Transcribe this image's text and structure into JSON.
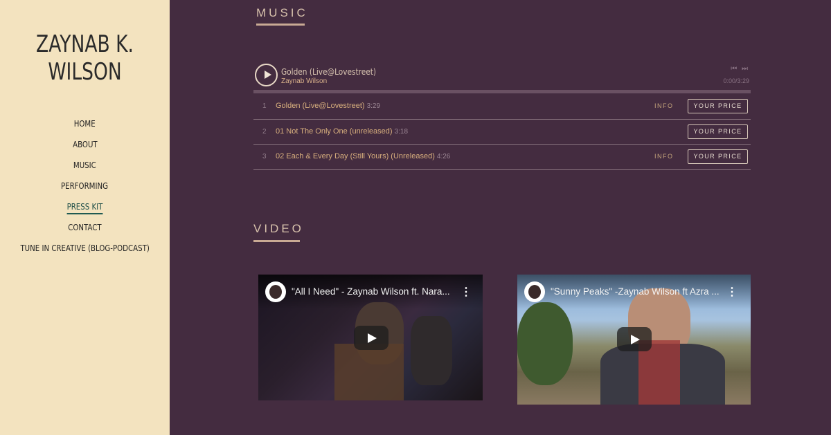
{
  "sidebar": {
    "title_line1": "ZAYNAB K.",
    "title_line2": "WILSON",
    "nav": [
      {
        "label": "HOME"
      },
      {
        "label": "ABOUT"
      },
      {
        "label": "MUSIC"
      },
      {
        "label": "PERFORMING"
      },
      {
        "label": "PRESS KIT",
        "active": true
      },
      {
        "label": "CONTACT"
      },
      {
        "label": "TUNE IN CREATIVE (BLOG-PODCAST)"
      }
    ]
  },
  "music": {
    "heading": "MUSIC",
    "player": {
      "now_playing_title": "Golden (Live@Lovestreet)",
      "artist": "Zaynab Wilson",
      "time": "0:00/3:29",
      "skip_icons": "⏮ ⏭"
    },
    "tracks": [
      {
        "num": "1",
        "title": "Golden (Live@Lovestreet)",
        "duration": "3:29",
        "info": "INFO",
        "price": "YOUR PRICE"
      },
      {
        "num": "2",
        "title": "01 Not The Only One (unreleased)",
        "duration": "3:18",
        "info": "",
        "price": "YOUR PRICE"
      },
      {
        "num": "3",
        "title": "02 Each & Every Day (Still Yours) (Unreleased)",
        "duration": "4:26",
        "info": "INFO",
        "price": "YOUR PRICE"
      }
    ]
  },
  "video": {
    "heading": "VIDEO",
    "items": [
      {
        "title": "\"All I Need\" - Zaynab Wilson ft. Nara..."
      },
      {
        "title": "\"Sunny Peaks\" -Zaynab Wilson ft Azra ..."
      }
    ]
  },
  "colors": {
    "sidebar_bg": "#f3e3bf",
    "main_bg": "#442c40",
    "accent": "#d9b07e"
  }
}
